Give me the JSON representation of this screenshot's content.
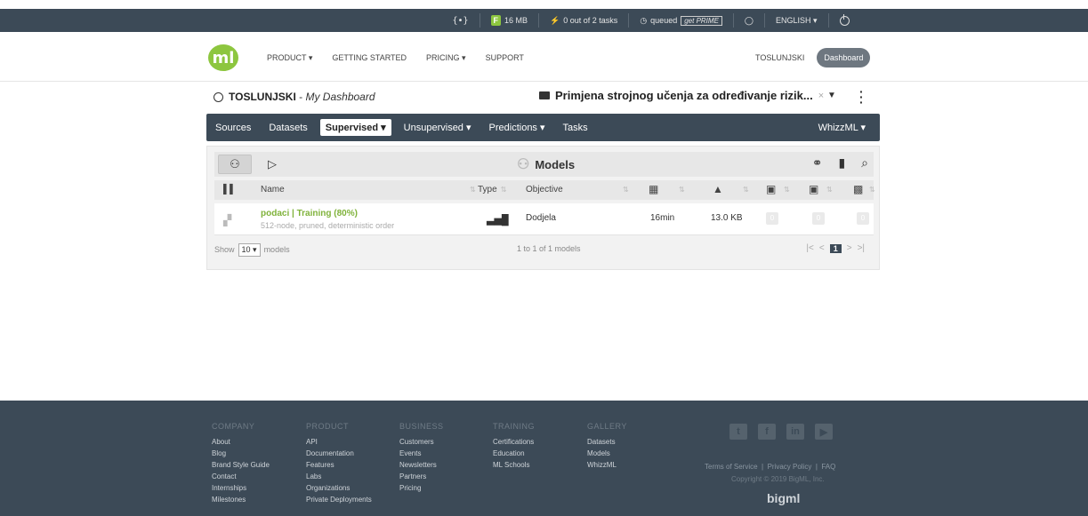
{
  "topbar": {
    "code_label": "{•}",
    "storage": "16 MB",
    "tasks": "0 out of 2 tasks",
    "queued": "queued",
    "prime": "get PRIME",
    "language": "ENGLISH ▾"
  },
  "header": {
    "logo": "ml",
    "nav": [
      "PRODUCT ▾",
      "GETTING STARTED",
      "PRICING ▾",
      "SUPPORT"
    ],
    "username": "TOSLUNJSKI",
    "dashboard_btn": "Dashboard"
  },
  "dashboard": {
    "user": "TOSLUNJSKI",
    "separator": " - ",
    "subtitle": "My Dashboard",
    "project": "Primjena strojnog učenja za određivanje rizik...",
    "project_close": "×"
  },
  "secnav": {
    "items": [
      "Sources",
      "Datasets",
      "Supervised ▾",
      "Unsupervised ▾",
      "Predictions ▾",
      "Tasks"
    ],
    "whizzml": "WhizzML ▾"
  },
  "panel": {
    "title": "Models",
    "columns": {
      "name": "Name",
      "type": "Type",
      "objective": "Objective"
    },
    "rows": [
      {
        "name": "podaci | Training (80%)",
        "sub": "512-node, pruned, deterministic order",
        "objective": "Dodjela",
        "age": "16min",
        "size": "13.0 KB",
        "b1": "0",
        "b2": "0",
        "b3": "0"
      }
    ],
    "footer": {
      "show": "Show",
      "count": "10",
      "unit": "models",
      "info": "1 to 1 of 1 models",
      "page": "1"
    }
  },
  "footer": {
    "company": {
      "title": "COMPANY",
      "links": [
        "About",
        "Blog",
        "Brand Style Guide",
        "Contact",
        "Internships",
        "Milestones"
      ]
    },
    "product": {
      "title": "PRODUCT",
      "links": [
        "API",
        "Documentation",
        "Features",
        "Labs",
        "Organizations",
        "Private Deployments"
      ]
    },
    "business": {
      "title": "BUSINESS",
      "links": [
        "Customers",
        "Events",
        "Newsletters",
        "Partners",
        "Pricing"
      ]
    },
    "training": {
      "title": "TRAINING",
      "links": [
        "Certifications",
        "Education",
        "ML Schools"
      ]
    },
    "gallery": {
      "title": "GALLERY",
      "links": [
        "Datasets",
        "Models",
        "WhizzML"
      ]
    },
    "terms": "Terms of Service",
    "privacy": "Privacy Policy",
    "faq": "FAQ",
    "copyright": "Copyright © 2019 BigML, Inc.",
    "brand": "bigml"
  }
}
